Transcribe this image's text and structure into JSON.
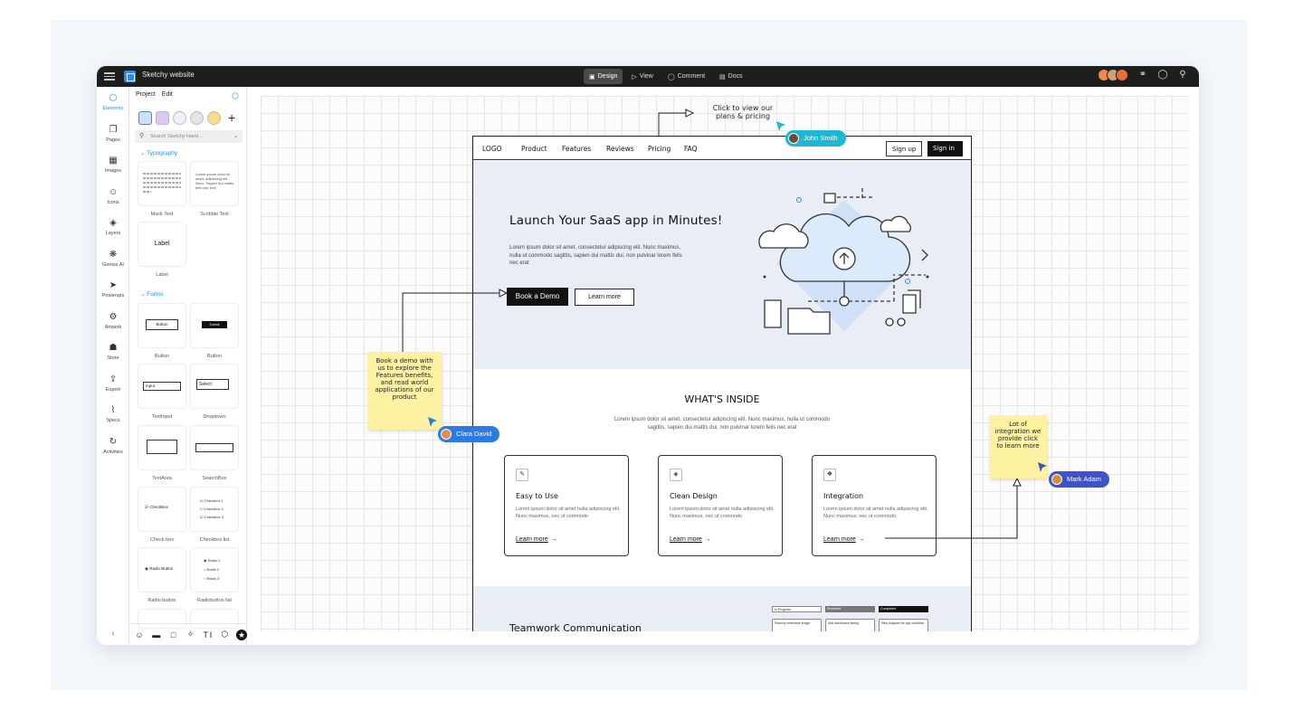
{
  "app": {
    "title": "Sketchy website",
    "tabs": [
      {
        "label": "Design",
        "icon": "design-icon"
      },
      {
        "label": "View",
        "icon": "play-icon"
      },
      {
        "label": "Comment",
        "icon": "comment-icon"
      },
      {
        "label": "Docs",
        "icon": "docs-icon"
      }
    ]
  },
  "rail": [
    {
      "label": "Elements",
      "icon": "cube-icon"
    },
    {
      "label": "Pages",
      "icon": "pages-icon"
    },
    {
      "label": "Images",
      "icon": "image-icon"
    },
    {
      "label": "Icons",
      "icon": "smiley-icon"
    },
    {
      "label": "Layers",
      "icon": "layers-icon"
    },
    {
      "label": "Genius AI",
      "icon": "ai-icon"
    },
    {
      "label": "Powerups",
      "icon": "rocket-icon"
    },
    {
      "label": "Artwork",
      "icon": "globe-icon"
    },
    {
      "label": "Store",
      "icon": "store-icon"
    },
    {
      "label": "Export",
      "icon": "export-icon"
    },
    {
      "label": "Specs",
      "icon": "specs-icon"
    },
    {
      "label": "Activities",
      "icon": "history-icon"
    }
  ],
  "panel": {
    "tabs": [
      "Project",
      "Edit"
    ],
    "search_placeholder": "Search Sketchy Hand...",
    "sections": {
      "typography": "Typography",
      "forms": "Forms"
    },
    "tiles": {
      "mock_text": "Mock Text",
      "scribble_text": "Scribble Text",
      "scribble_sample": "Lorem ipsum dolor sit amet, adipiscing elit Nunc, Sapien dui mattis felis nec erat",
      "label_tile": "Label",
      "label_caption": "Label",
      "button1_inner": "Button",
      "button1": "Button",
      "button2_inner": "Submit",
      "button2": "Button",
      "textinput_inner": "Input",
      "textinput": "TextInput",
      "dropdown_inner": "Select",
      "dropdown": "Dropdown",
      "textarea": "TextArea",
      "searchbox": "SearchBox",
      "checkbox_inner": "CheckBox",
      "checkbox": "Check box",
      "checkbox_list_items": [
        "Checkbox 1",
        "Checkbox 2",
        "Checkbox 3"
      ],
      "checkbox_list": "Checkbox list",
      "radio_inner": "Radio Button",
      "radio": "Radio button",
      "radio_list_items": [
        "Radio 1",
        "Radio 2",
        "Radio 3"
      ],
      "radio_list": "Radiobutton list"
    }
  },
  "page": {
    "nav": {
      "logo": "LOGO",
      "links": [
        "Product",
        "Features",
        "Reviews",
        "Pricing",
        "FAQ"
      ],
      "signup": "Sign up",
      "signin": "Sign in"
    },
    "hero": {
      "title": "Launch Your SaaS app in Minutes!",
      "body": "Lorem ipsum dolor sit amet, consectetur adipiscing elit. Nunc maximus, nulla ut commodo sagittis, sapien dui mattis dui, non pulvinar lorem felis nec erat",
      "cta_primary": "Book a Demo",
      "cta_secondary": "Learn more"
    },
    "inside": {
      "title": "WHAT'S INSIDE",
      "lead": "Lorem ipsum dolor sit amet, consectetur adipiscing elit. Nunc maximus, nulla ut commodo sagittis, sapien dui mattis dui, non pulvinar lorem felis nec erat",
      "cards": [
        {
          "title": "Easy to Use",
          "icon": "edit-icon",
          "body": "Lorem ipsum dolor sit amet nulla adipiscing elit. Nunc maximus, nec ut commodo",
          "link": "Learn more"
        },
        {
          "title": "Clean Design",
          "icon": "layers-icon",
          "body": "Lorem ipsum dolor sit amet nulla adipiscing elit. Nunc maximus, nec ut commodo",
          "link": "Learn more"
        },
        {
          "title": "Integration",
          "icon": "puzzle-icon",
          "body": "Lorem ipsum dolor sit amet nulla adipiscing elit. Nunc maximus, nec ut commodo",
          "link": "Learn more"
        }
      ]
    },
    "team": {
      "title": "Teamwork Communication",
      "kanban": [
        {
          "head": "In Progress",
          "card": "Sketchy wireframe image"
        },
        {
          "head": "Reviewed",
          "card": "Add dashboard facing"
        },
        {
          "head": "Completed",
          "card": "New diagram for app workflow"
        }
      ]
    }
  },
  "annotations": {
    "callout_top": "Click to view our plans & pricing",
    "note_left": "Book a demo with us to explore the Features benefits, and read world applications of our product",
    "note_right": "Lot of integration we provide click to learn more",
    "users": [
      {
        "name": "John Smith",
        "color": "#1fb8d4"
      },
      {
        "name": "Clara David",
        "color": "#2b7be4"
      },
      {
        "name": "Mark Adam",
        "color": "#3f52c8"
      }
    ]
  }
}
